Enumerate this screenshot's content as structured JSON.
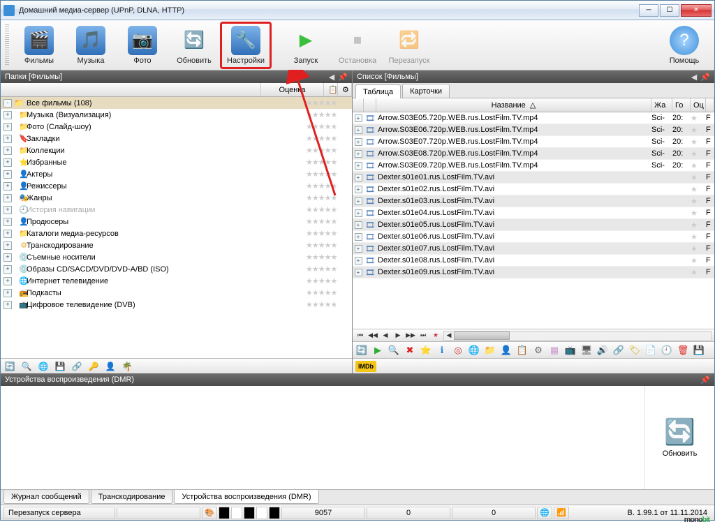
{
  "window": {
    "title": "Домашний медиа-сервер (UPnP, DLNA, HTTP)"
  },
  "toolbar": {
    "films": "Фильмы",
    "music": "Музыка",
    "photo": "Фото",
    "refresh": "Обновить",
    "settings": "Настройки",
    "start": "Запуск",
    "stop": "Остановка",
    "restart": "Перезапуск",
    "help": "Помощь"
  },
  "panels": {
    "folders_title": "Папки [Фильмы]",
    "list_title": "Список [Фильмы]",
    "dmr_title": "Устройства воспроизведения (DMR)"
  },
  "left_columns": {
    "rating": "Оценка"
  },
  "tree": [
    {
      "label": "Все фильмы (108)",
      "icon": "📁",
      "sel": true,
      "exp": "-"
    },
    {
      "label": "Музыка (Визуализация)",
      "icon": "📁",
      "exp": "+"
    },
    {
      "label": "Фото (Слайд-шоу)",
      "icon": "📁",
      "exp": "+"
    },
    {
      "label": "Закладки",
      "icon": "🔖",
      "exp": "+"
    },
    {
      "label": "Коллекции",
      "icon": "📁",
      "exp": "+"
    },
    {
      "label": "Избранные",
      "icon": "⭐",
      "exp": "+"
    },
    {
      "label": "Актеры",
      "icon": "👤",
      "exp": "+"
    },
    {
      "label": "Режиссеры",
      "icon": "👤",
      "exp": "+"
    },
    {
      "label": "Жанры",
      "icon": "🎭",
      "exp": "+"
    },
    {
      "label": "История навигации",
      "icon": "🕘",
      "exp": "+",
      "dim": true
    },
    {
      "label": "Продюсеры",
      "icon": "👤",
      "exp": "+"
    },
    {
      "label": "Каталоги медиа-ресурсов",
      "icon": "📁",
      "exp": "+"
    },
    {
      "label": "Транскодирование",
      "icon": "⚙",
      "exp": "+"
    },
    {
      "label": "Съемные носители",
      "icon": "💿",
      "exp": "+"
    },
    {
      "label": "Образы CD/SACD/DVD/DVD-A/BD (ISO)",
      "icon": "💿",
      "exp": "+"
    },
    {
      "label": "Интернет телевидение",
      "icon": "🌐",
      "exp": "+"
    },
    {
      "label": "Подкасты",
      "icon": "📻",
      "exp": "+"
    },
    {
      "label": "Цифровое телевидение (DVB)",
      "icon": "📺",
      "exp": "+"
    }
  ],
  "tabs": {
    "table": "Таблица",
    "cards": "Карточки"
  },
  "grid_columns": {
    "name": "Название",
    "genre": "Жа",
    "year": "Го",
    "rate": "Оц"
  },
  "files": [
    {
      "name": "Arrow.S03E05.720p.WEB.rus.LostFilm.TV.mp4",
      "genre": "Sci-",
      "year": "20:",
      "alt": false
    },
    {
      "name": "Arrow.S03E06.720p.WEB.rus.LostFilm.TV.mp4",
      "genre": "Sci-",
      "year": "20:",
      "alt": true
    },
    {
      "name": "Arrow.S03E07.720p.WEB.rus.LostFilm.TV.mp4",
      "genre": "Sci-",
      "year": "20:",
      "alt": false
    },
    {
      "name": "Arrow.S03E08.720p.WEB.rus.LostFilm.TV.mp4",
      "genre": "Sci-",
      "year": "20:",
      "alt": true
    },
    {
      "name": "Arrow.S03E09.720p.WEB.rus.LostFilm.TV.mp4",
      "genre": "Sci-",
      "year": "20:",
      "alt": false
    },
    {
      "name": "Dexter.s01e01.rus.LostFilm.TV.avi",
      "genre": "",
      "year": "",
      "alt": true
    },
    {
      "name": "Dexter.s01e02.rus.LostFilm.TV.avi",
      "genre": "",
      "year": "",
      "alt": false
    },
    {
      "name": "Dexter.s01e03.rus.LostFilm.TV.avi",
      "genre": "",
      "year": "",
      "alt": true
    },
    {
      "name": "Dexter.s01e04.rus.LostFilm.TV.avi",
      "genre": "",
      "year": "",
      "alt": false
    },
    {
      "name": "Dexter.s01e05.rus.LostFilm.TV.avi",
      "genre": "",
      "year": "",
      "alt": true
    },
    {
      "name": "Dexter.s01e06.rus.LostFilm.TV.avi",
      "genre": "",
      "year": "",
      "alt": false
    },
    {
      "name": "Dexter.s01e07.rus.LostFilm.TV.avi",
      "genre": "",
      "year": "",
      "alt": true
    },
    {
      "name": "Dexter.s01e08.rus.LostFilm.TV.avi",
      "genre": "",
      "year": "",
      "alt": false
    },
    {
      "name": "Dexter.s01e09.rus.LostFilm.TV.avi",
      "genre": "",
      "year": "",
      "alt": true
    }
  ],
  "dmr": {
    "refresh": "Обновить"
  },
  "bottom_tabs": {
    "log": "Журнал сообщений",
    "transcode": "Транскодирование",
    "dmr": "Устройства воспроизведения (DMR)"
  },
  "status": {
    "restart": "Перезапуск сервера",
    "count1": "9057",
    "count2": "0",
    "count3": "0",
    "version": "В. 1.99.1 от 11.11.2014"
  },
  "imdb_badge": "IMDb"
}
